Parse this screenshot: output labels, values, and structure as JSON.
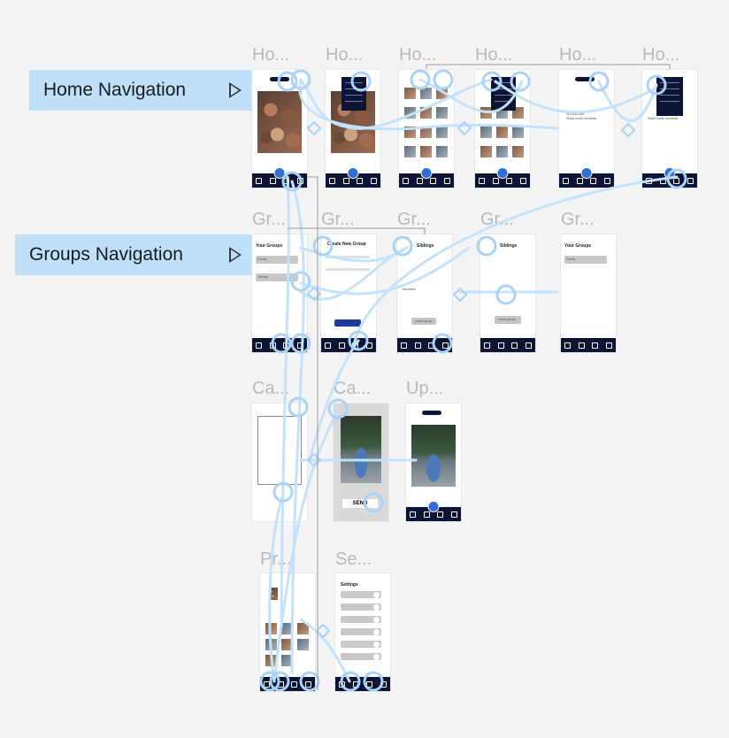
{
  "flows": [
    {
      "label": "Home Navigation"
    },
    {
      "label": "Groups Navigation"
    }
  ],
  "frame_titles": {
    "row1": [
      "Ho...",
      "Ho...",
      "Ho...",
      "Ho...",
      "Ho...",
      "Ho..."
    ],
    "row2": [
      "Gr...",
      "Gr...",
      "Gr...",
      "Gr...",
      "Gr..."
    ],
    "row3": [
      "Ca...",
      "Ca...",
      "Up..."
    ],
    "row4": [
      "Pr...",
      "Se..."
    ]
  },
  "screens": {
    "groups_your": {
      "title": "Your Groups",
      "rows": [
        "Family",
        "Siblings"
      ]
    },
    "create_group": {
      "title": "Create New Group",
      "button": ""
    },
    "siblings_1": {
      "title": "Siblings",
      "members_label": "Members",
      "leave": "Leave group"
    },
    "siblings_2": {
      "title": "Siblings",
      "leave": "Leave group"
    },
    "your_groups_2": {
      "title": "Your Groups",
      "row": "Family"
    },
    "home_empty": {
      "line1": "No posts yet!",
      "line2": "Share some moments"
    },
    "camera_send": {
      "button": "SEND"
    },
    "settings": {
      "title": "Settings"
    }
  },
  "colors": {
    "canvas": "#f4f4f4",
    "label_bg": "#bfe0fb",
    "navbar": "#0e1436",
    "wire": "#c4e2fb",
    "wire_node": "#a9d3f8"
  }
}
